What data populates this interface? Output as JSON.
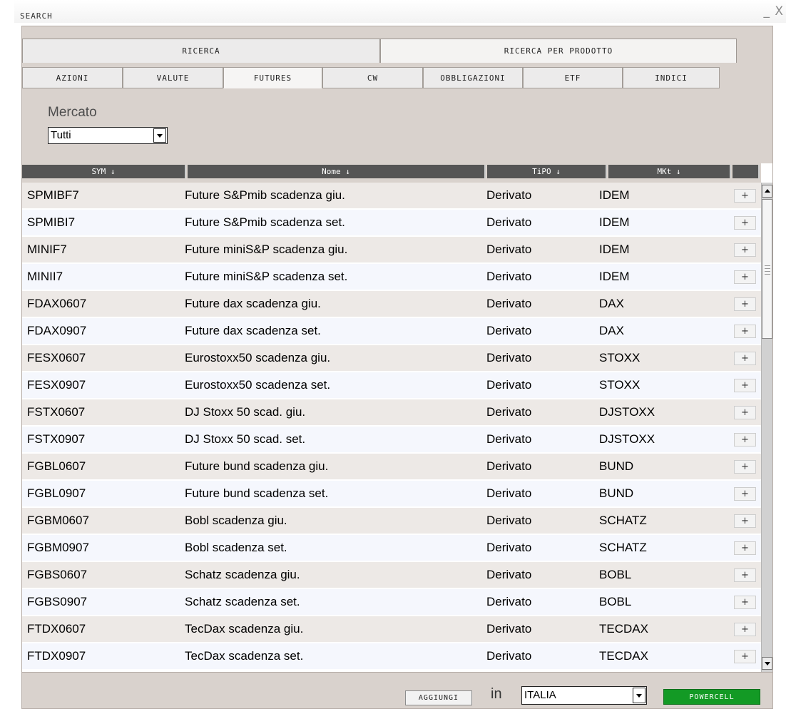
{
  "window": {
    "title": "SEARCH",
    "minimize": "_",
    "close": "X"
  },
  "tabs": [
    {
      "label": "RICERCA"
    },
    {
      "label": "RICERCA PER PRODOTTO"
    }
  ],
  "subtabs": [
    {
      "label": "AZIONI"
    },
    {
      "label": "VALUTE"
    },
    {
      "label": "FUTURES"
    },
    {
      "label": "CW"
    },
    {
      "label": "OBBLIGAZIONI"
    },
    {
      "label": "ETF"
    },
    {
      "label": "INDICI"
    }
  ],
  "active_subtab": "FUTURES",
  "filter": {
    "label": "Mercato",
    "value": "Tutti"
  },
  "table": {
    "columns": [
      {
        "label": "SYM ↓"
      },
      {
        "label": "Nome ↓"
      },
      {
        "label": "TiPO ↓"
      },
      {
        "label": "MKt ↓"
      }
    ],
    "add_label": "+",
    "rows": [
      {
        "sym": "SPMIBF7",
        "nome": "Future S&Pmib scadenza giu.",
        "tipo": "Derivato",
        "mkt": "IDEM"
      },
      {
        "sym": "SPMIBI7",
        "nome": "Future S&Pmib scadenza set.",
        "tipo": "Derivato",
        "mkt": "IDEM"
      },
      {
        "sym": "MINIF7",
        "nome": "Future miniS&P scadenza giu.",
        "tipo": "Derivato",
        "mkt": "IDEM"
      },
      {
        "sym": "MINII7",
        "nome": "Future miniS&P scadenza set.",
        "tipo": "Derivato",
        "mkt": "IDEM"
      },
      {
        "sym": "FDAX0607",
        "nome": "Future dax scadenza giu.",
        "tipo": "Derivato",
        "mkt": "DAX"
      },
      {
        "sym": "FDAX0907",
        "nome": "Future dax scadenza set.",
        "tipo": "Derivato",
        "mkt": "DAX"
      },
      {
        "sym": "FESX0607",
        "nome": "Eurostoxx50 scadenza giu.",
        "tipo": "Derivato",
        "mkt": "STOXX"
      },
      {
        "sym": "FESX0907",
        "nome": "Eurostoxx50 scadenza set.",
        "tipo": "Derivato",
        "mkt": "STOXX"
      },
      {
        "sym": "FSTX0607",
        "nome": "DJ Stoxx 50 scad. giu.",
        "tipo": "Derivato",
        "mkt": "DJSTOXX"
      },
      {
        "sym": "FSTX0907",
        "nome": "DJ Stoxx 50 scad. set.",
        "tipo": "Derivato",
        "mkt": "DJSTOXX"
      },
      {
        "sym": "FGBL0607",
        "nome": "Future bund scadenza giu.",
        "tipo": "Derivato",
        "mkt": "BUND"
      },
      {
        "sym": "FGBL0907",
        "nome": "Future bund scadenza set.",
        "tipo": "Derivato",
        "mkt": "BUND"
      },
      {
        "sym": "FGBM0607",
        "nome": "Bobl scadenza giu.",
        "tipo": "Derivato",
        "mkt": "SCHATZ"
      },
      {
        "sym": "FGBM0907",
        "nome": "Bobl scadenza set.",
        "tipo": "Derivato",
        "mkt": "SCHATZ"
      },
      {
        "sym": "FGBS0607",
        "nome": "Schatz scadenza giu.",
        "tipo": "Derivato",
        "mkt": "BOBL"
      },
      {
        "sym": "FGBS0907",
        "nome": "Schatz scadenza set.",
        "tipo": "Derivato",
        "mkt": "BOBL"
      },
      {
        "sym": "FTDX0607",
        "nome": "TecDax scadenza giu.",
        "tipo": "Derivato",
        "mkt": "TECDAX"
      },
      {
        "sym": "FTDX0907",
        "nome": "TecDax scadenza set.",
        "tipo": "Derivato",
        "mkt": "TECDAX"
      }
    ]
  },
  "footer": {
    "add_button": "AGGIUNGI",
    "in_label": "in",
    "target_value": "ITALIA",
    "power_button": "POWERCELL"
  },
  "colors": {
    "panel_bg": "#d9d2cd",
    "header_bg": "#555555",
    "powercell_green": "#139a25"
  },
  "icons": [
    "sort-down-icon",
    "dropdown-arrow-icon",
    "scroll-up-icon",
    "scroll-down-icon",
    "plus-icon"
  ]
}
